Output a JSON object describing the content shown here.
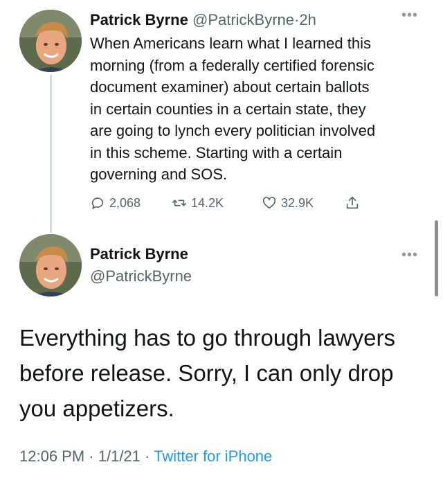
{
  "tweet1": {
    "name": "Patrick Byrne",
    "handle": "@PatrickByrne",
    "separator": "·",
    "time": "2h",
    "text_lines": [
      "When Americans learn what I learned this",
      "morning (from a federally certified forensic",
      "document examiner) about certain ballots",
      "in certain counties in a certain state, they",
      "are going to lynch every politician involved",
      "in this scheme. Starting with a certain",
      "governing and SOS."
    ],
    "replies": "2,068",
    "retweets": "14.2K",
    "likes": "32.9K",
    "more_icon": "more-dots-icon"
  },
  "tweet2": {
    "name": "Patrick Byrne",
    "handle": "@PatrickByrne",
    "text_lines": [
      "Everything has to go through lawyers",
      "before release. Sorry, I can only drop",
      "you appetizers."
    ],
    "time": "12:06 PM",
    "date": "1/1/21",
    "separator": "·",
    "source": "Twitter for iPhone"
  },
  "colors": {
    "text": "#0f1419",
    "secondary": "#536471",
    "link": "#1d9bf0",
    "thread_line": "#cfd9de"
  },
  "icons": [
    "reply-icon",
    "retweet-icon",
    "like-icon",
    "share-icon",
    "more-dots-icon"
  ]
}
